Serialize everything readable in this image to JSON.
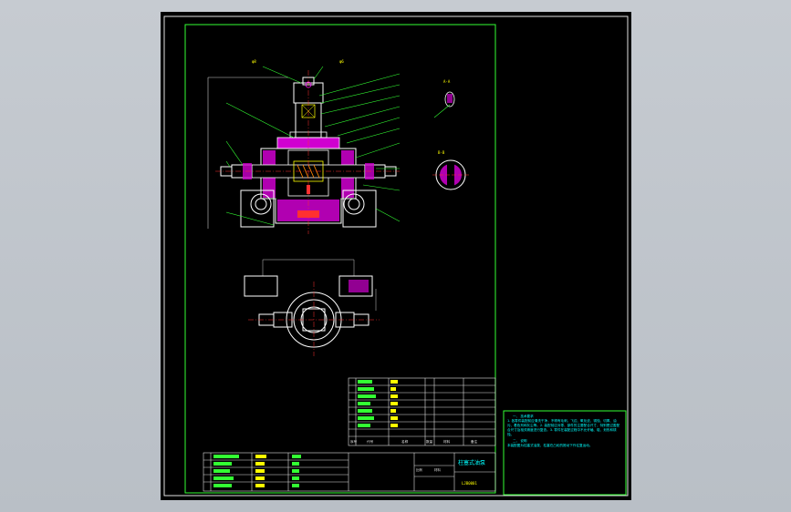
{
  "drawing": {
    "title": "柱塞式油泵",
    "labels": {
      "section_a": "A-A",
      "section_b": "B-B",
      "scale_label": "比例",
      "material_label": "材料"
    },
    "tech_notes": {
      "heading": "一、 技术要求",
      "body": "1. 各零件装配前应清洗干净，不得有毛刺，飞边、氧化皮、锈蚀、切屑、油污、着色剂和灰尘等。2. 装配前应对零、部件的主要配合尺寸，特别是过盈配合尺寸及相关精度进行复查。3. 零件在装配过程中不允许磕、碰、划伤和锈蚀。",
      "heading2": "二、 说明",
      "body2": "本装配图为柱塞式油泵，柱塞在凸轮的推动下作往复运动。"
    },
    "title_block": {
      "drawing_no": "LJB0001",
      "cols": [
        "序号",
        "代号",
        "名称",
        "数量",
        "材料",
        "备注"
      ]
    }
  }
}
